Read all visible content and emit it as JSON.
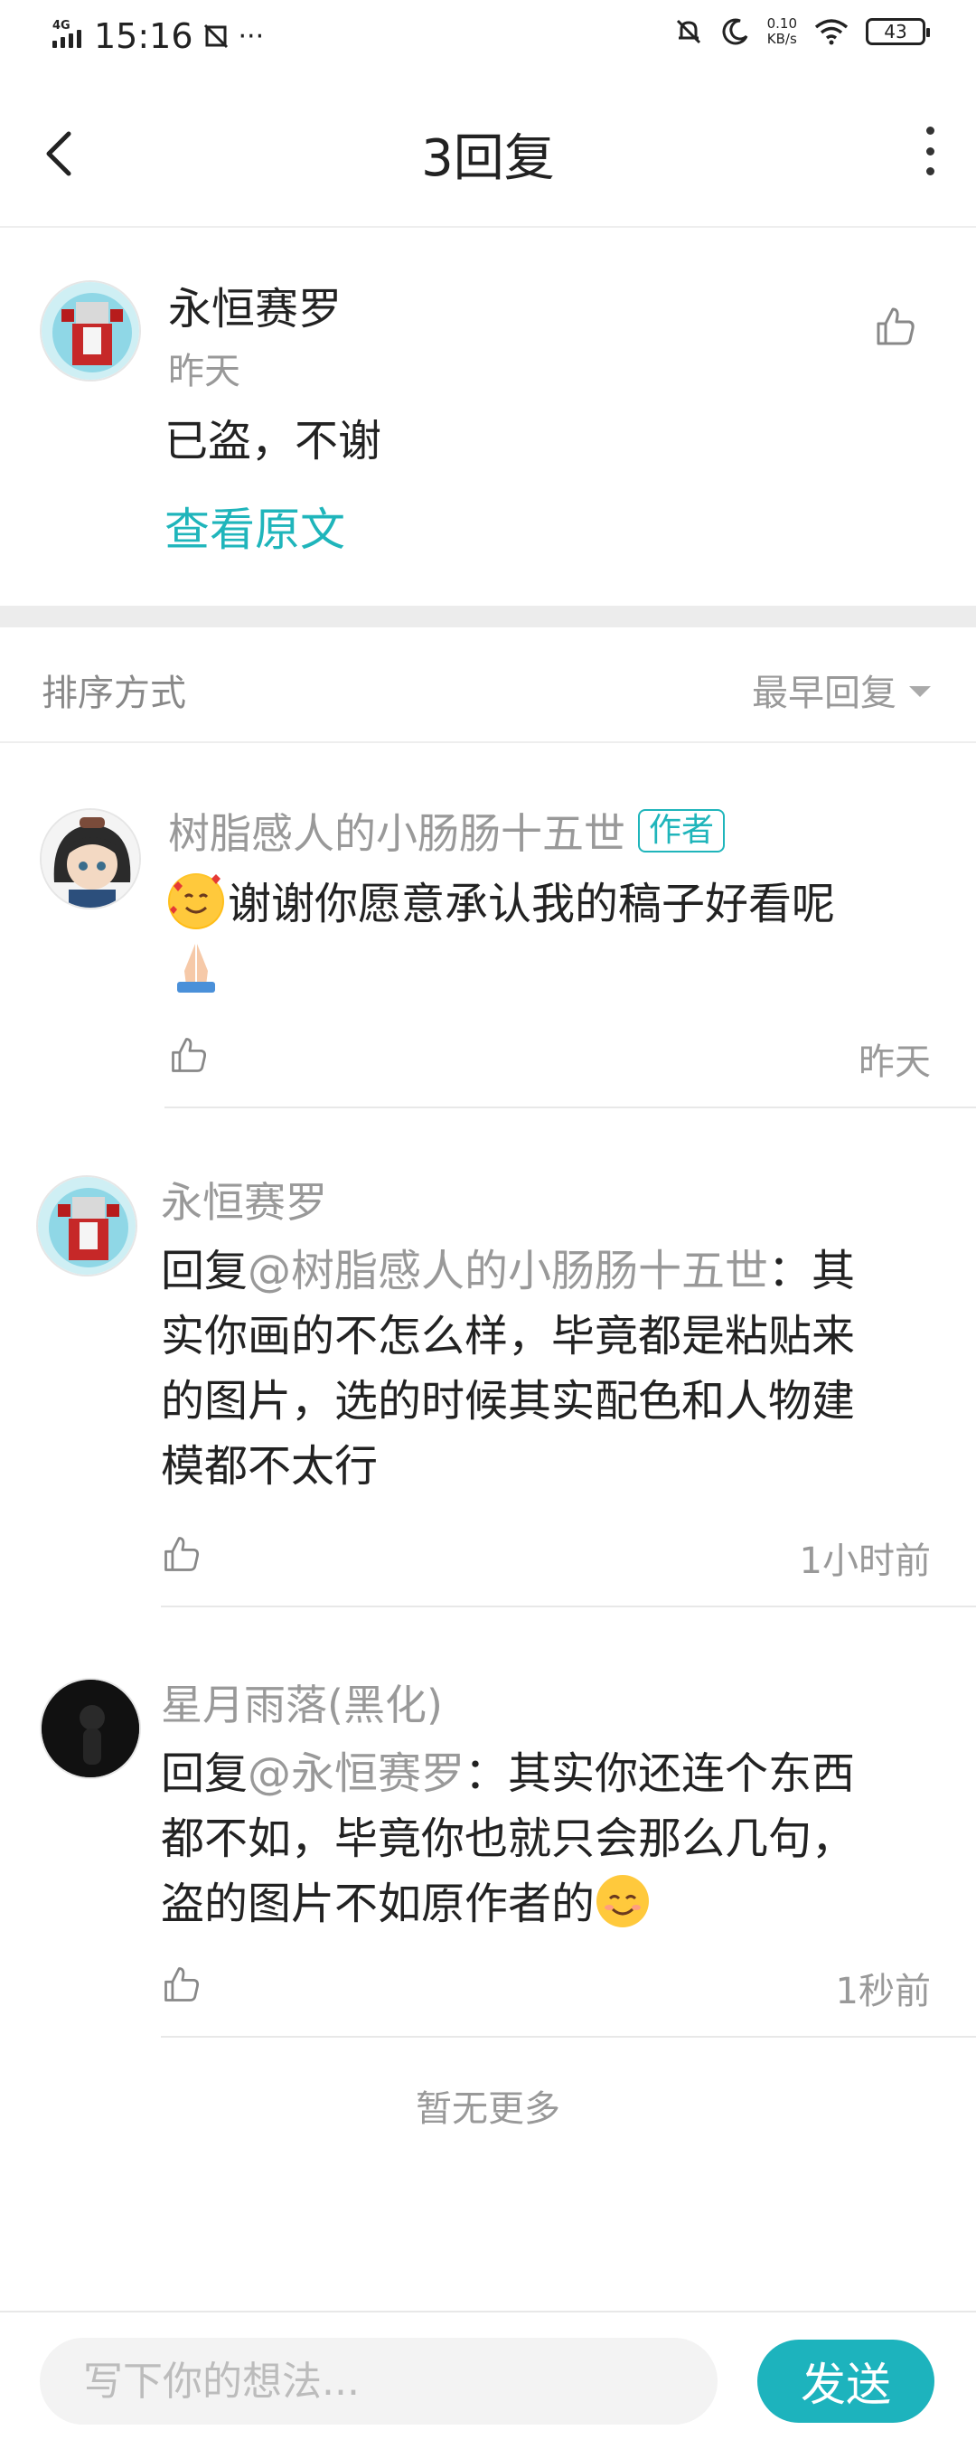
{
  "status_bar": {
    "network": "4G",
    "time": "15:16",
    "extra_icons": "···",
    "speed_value": "0.10",
    "speed_unit": "KB/s",
    "battery": "43"
  },
  "header": {
    "title": "3回复"
  },
  "original": {
    "author": "永恒赛罗",
    "time": "昨天",
    "text": "已盗，不谢",
    "view_original": "查看原文"
  },
  "sort": {
    "label": "排序方式",
    "selected": "最早回复"
  },
  "replies": [
    {
      "author": "树脂感人的小肠肠十五世",
      "badge": "作者",
      "text": "谢谢你愿意承认我的稿子好看呢",
      "time": "昨天"
    },
    {
      "author": "永恒赛罗",
      "reply_prefix": "回复",
      "mention": "@树脂感人的小肠肠十五世",
      "text_line1": "：其",
      "text_line2": "实你画的不怎么样，毕竟都是粘贴来",
      "text_line3": "的图片，选的时候其实配色和人物建",
      "text_line4": "模都不太行",
      "time": "1小时前"
    },
    {
      "author": "星月雨落(黑化)",
      "reply_prefix": "回复",
      "mention": "@永恒赛罗",
      "text_line1": "：其实你还连个东西",
      "text_line2": "都不如，毕竟你也就只会那么几句，",
      "text_line3": "盗的图片不如原作者的",
      "time": "1秒前"
    }
  ],
  "footer_note": "暂无更多",
  "composer": {
    "placeholder": "写下你的想法...",
    "send_label": "发送"
  },
  "colors": {
    "accent": "#1fb5bb",
    "muted": "#999999"
  }
}
